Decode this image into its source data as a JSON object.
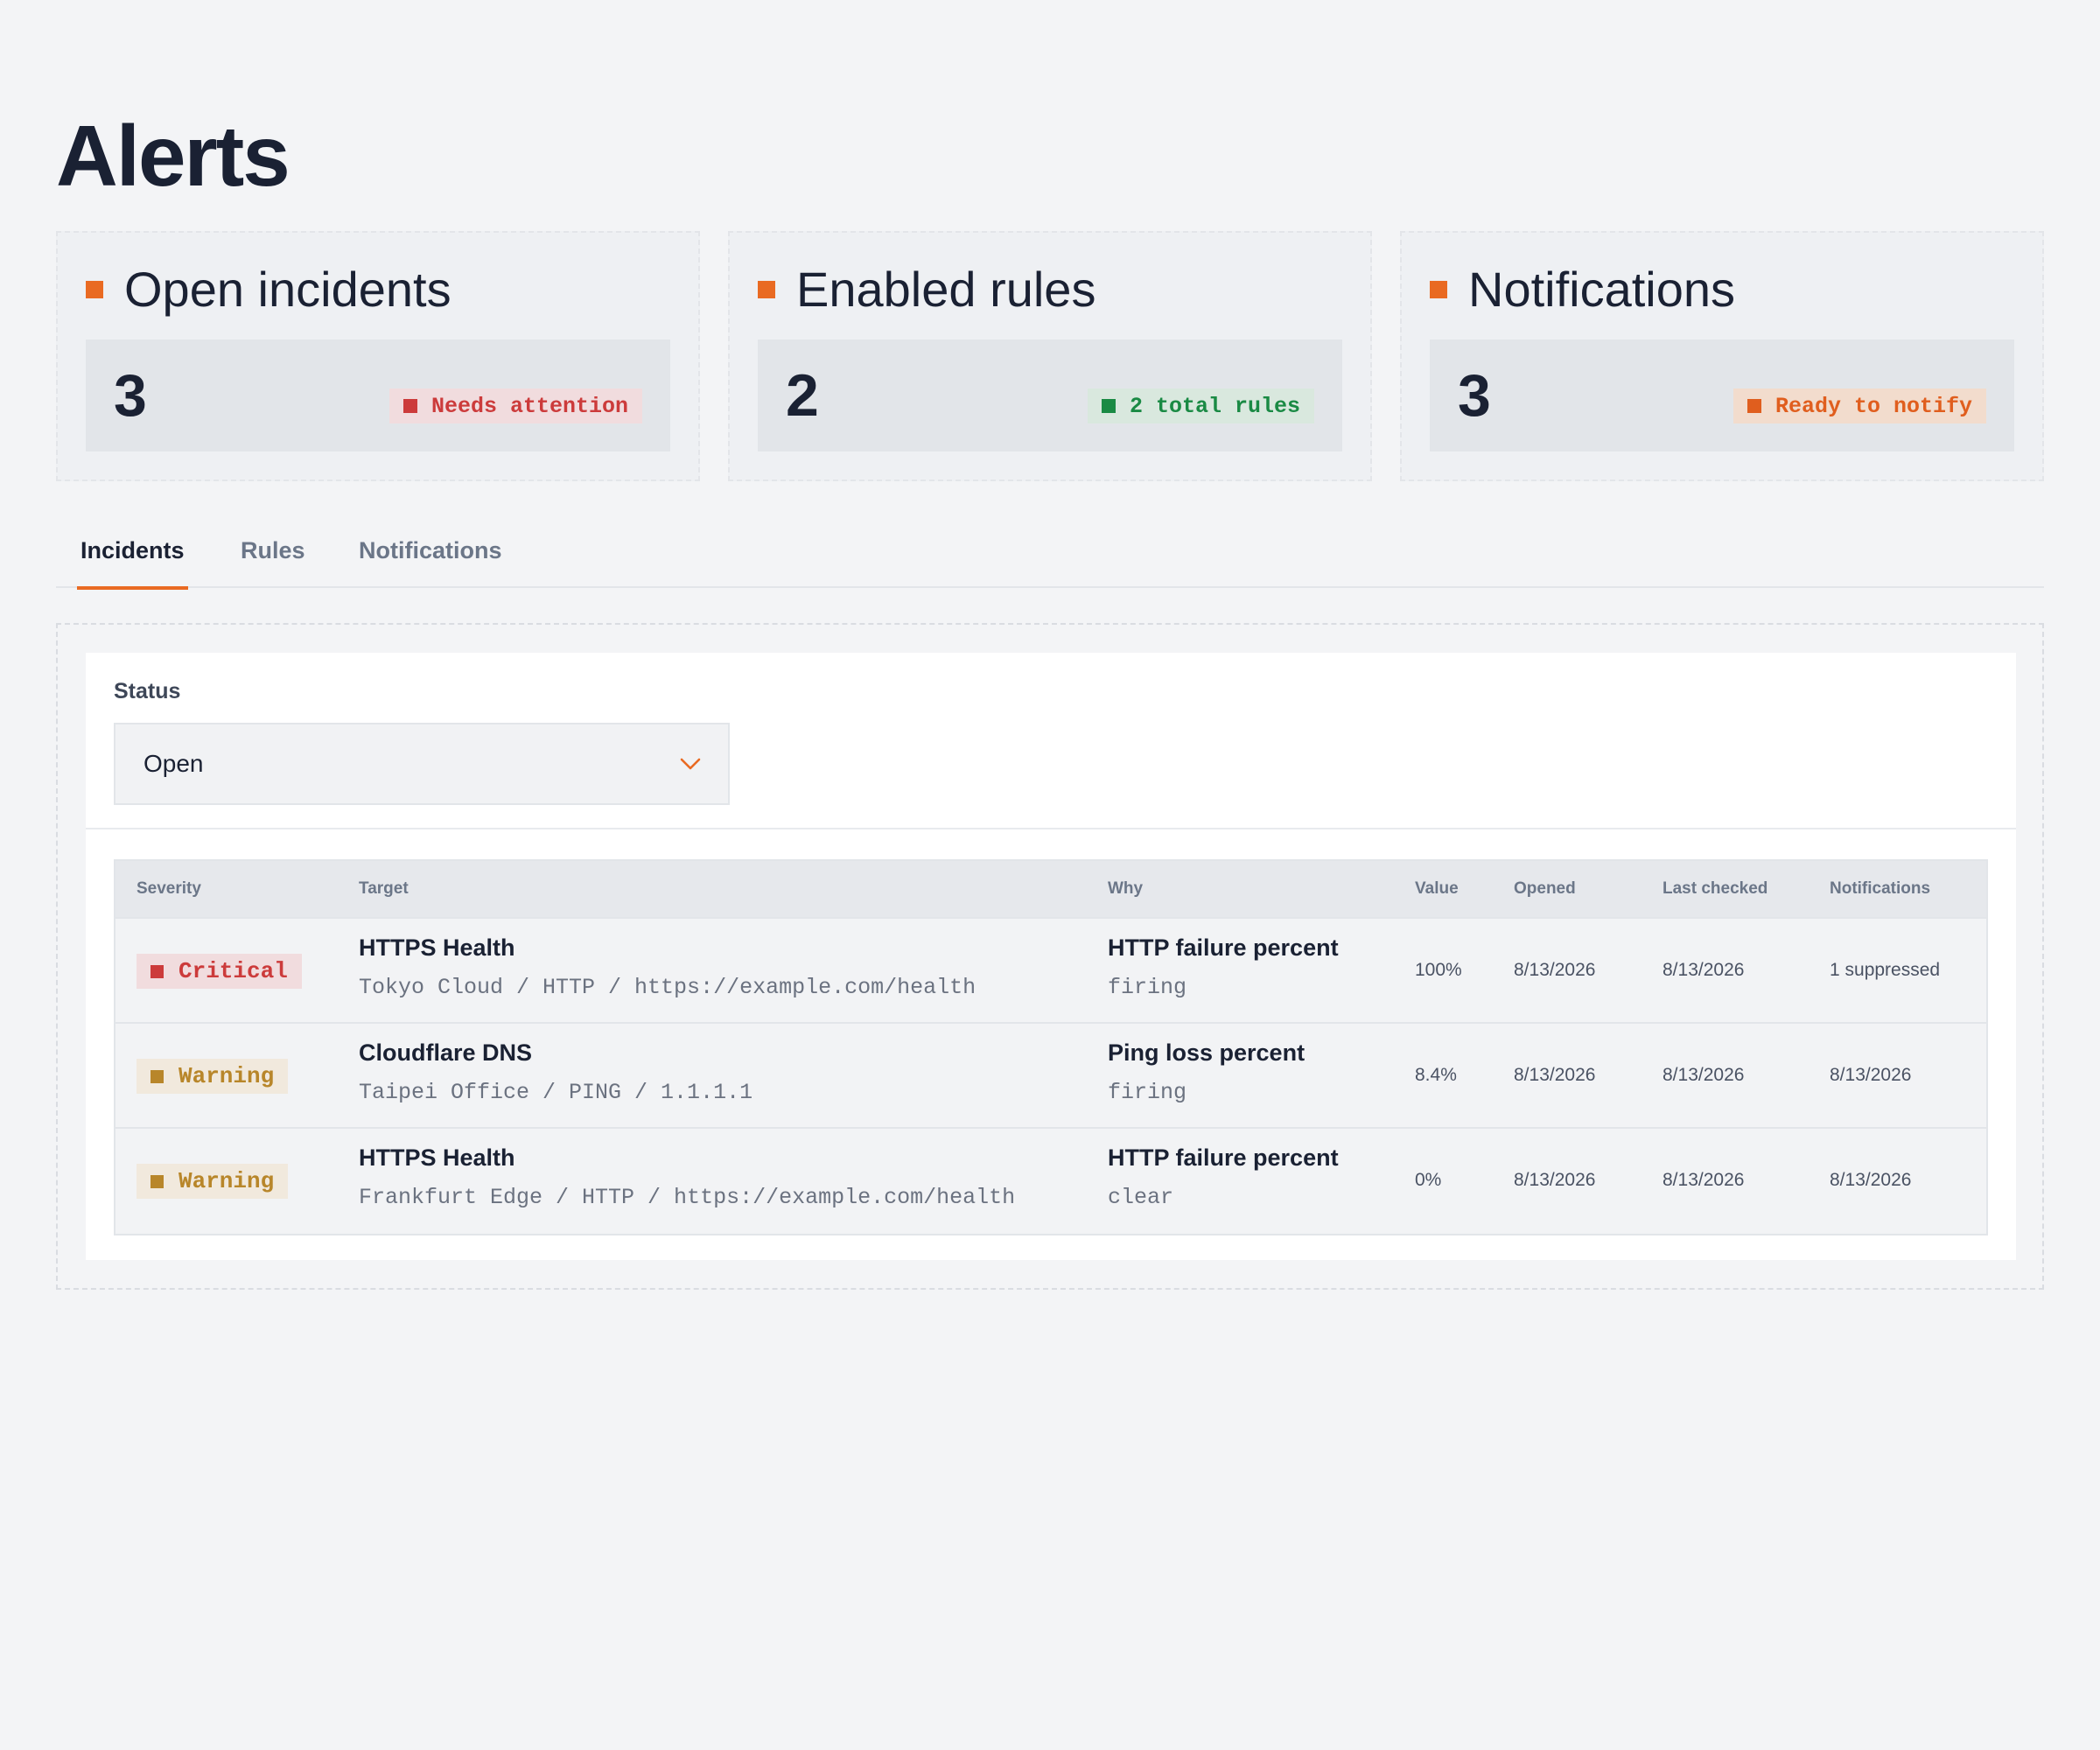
{
  "page": {
    "title": "Alerts"
  },
  "colors": {
    "accent": "#e96a22",
    "critical": "#cc3b3b",
    "critical_bg": "#f1dcde",
    "warning": "#b8862a",
    "warning_bg": "#f1e9dd",
    "success": "#1a8a44",
    "success_bg": "#d9e8de",
    "notify": "#e05e1e",
    "notify_bg": "#f2dccd"
  },
  "cards": [
    {
      "title": "Open incidents",
      "value": "3",
      "badge": "Needs attention",
      "tone": "critical"
    },
    {
      "title": "Enabled rules",
      "value": "2",
      "badge": "2 total rules",
      "tone": "success"
    },
    {
      "title": "Notifications",
      "value": "3",
      "badge": "Ready to notify",
      "tone": "notify"
    }
  ],
  "tabs": [
    {
      "label": "Incidents",
      "active": true
    },
    {
      "label": "Rules",
      "active": false
    },
    {
      "label": "Notifications",
      "active": false
    }
  ],
  "filter": {
    "label": "Status",
    "selected": "Open",
    "icon": "chevron-down-icon"
  },
  "table": {
    "columns": [
      "Severity",
      "Target",
      "Why",
      "Value",
      "Opened",
      "Last checked",
      "Notifications"
    ],
    "rows": [
      {
        "severity": "Critical",
        "tone": "critical",
        "target_name": "HTTPS Health",
        "target_detail": "Tokyo Cloud / HTTP / https://example.com/health",
        "why_rule": "HTTP failure percent",
        "why_state": "firing",
        "value": "100%",
        "opened": "8/13/2026",
        "last_checked": "8/13/2026",
        "notifications": "1 suppressed"
      },
      {
        "severity": "Warning",
        "tone": "warning",
        "target_name": "Cloudflare DNS",
        "target_detail": "Taipei Office / PING / 1.1.1.1",
        "why_rule": "Ping loss percent",
        "why_state": "firing",
        "value": "8.4%",
        "opened": "8/13/2026",
        "last_checked": "8/13/2026",
        "notifications": "8/13/2026"
      },
      {
        "severity": "Warning",
        "tone": "warning",
        "target_name": "HTTPS Health",
        "target_detail": "Frankfurt Edge / HTTP / https://example.com/health",
        "why_rule": "HTTP failure percent",
        "why_state": "clear",
        "value": "0%",
        "opened": "8/13/2026",
        "last_checked": "8/13/2026",
        "notifications": "8/13/2026"
      }
    ]
  }
}
